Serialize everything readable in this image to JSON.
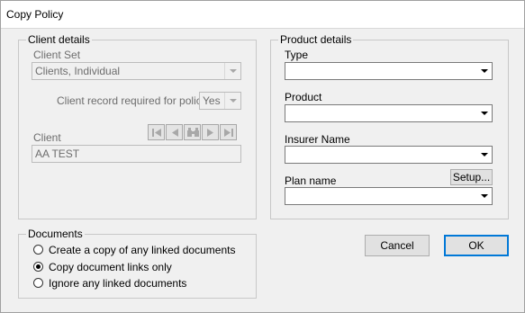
{
  "window": {
    "title": "Copy Policy"
  },
  "client_details": {
    "legend": "Client details",
    "client_set_label": "Client Set",
    "client_set_value": "Clients, Individual",
    "record_required_label": "Client record required for policy?",
    "record_required_value": "Yes",
    "client_label": "Client",
    "client_value": "AA TEST",
    "nav_buttons": [
      "first-icon",
      "previous-icon",
      "find-icon",
      "next-icon",
      "last-icon"
    ]
  },
  "product_details": {
    "legend": "Product details",
    "type_label": "Type",
    "type_value": "",
    "product_label": "Product",
    "product_value": "",
    "insurer_label": "Insurer Name",
    "insurer_value": "",
    "plan_label": "Plan name",
    "plan_value": "",
    "setup_button": "Setup..."
  },
  "documents": {
    "legend": "Documents",
    "options": [
      {
        "label": "Create a copy of any linked documents",
        "checked": false
      },
      {
        "label": "Copy document links only",
        "checked": true
      },
      {
        "label": "Ignore any linked documents",
        "checked": false
      }
    ]
  },
  "buttons": {
    "cancel": "Cancel",
    "ok": "OK"
  }
}
